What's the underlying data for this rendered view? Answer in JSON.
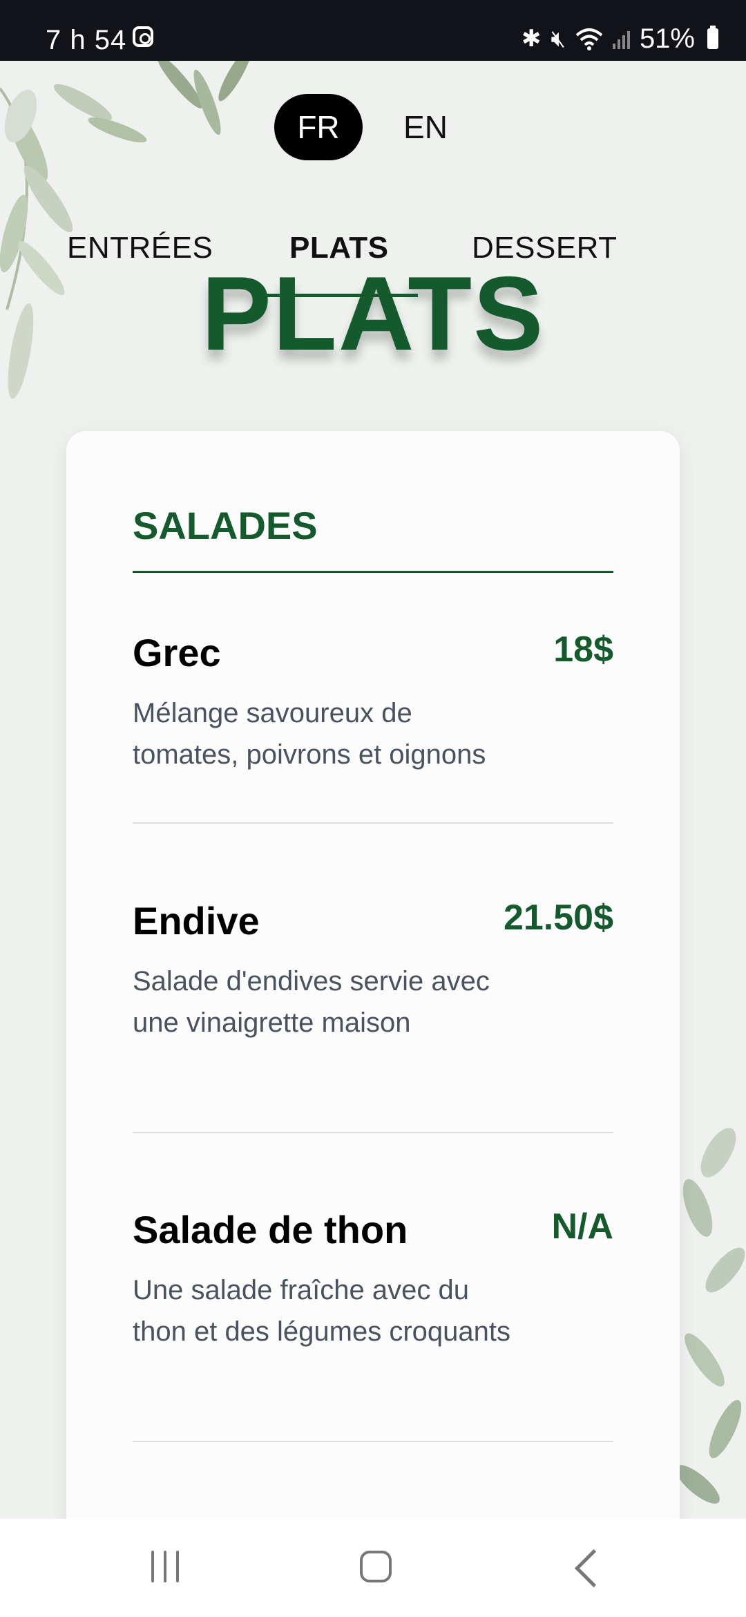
{
  "status_bar": {
    "time": "7 h 54",
    "battery": "51%",
    "icons": [
      "instagram-icon",
      "bluetooth-icon",
      "mute-icon",
      "wifi-icon",
      "signal-icon",
      "battery-icon"
    ]
  },
  "language": {
    "fr": "FR",
    "en": "EN",
    "selected": "FR"
  },
  "tabs": [
    {
      "label": "ENTRÉES"
    },
    {
      "label": "PLATS",
      "active": true
    },
    {
      "label": "DESSERT"
    }
  ],
  "page_title": "PLATS",
  "section": {
    "title": "SALADES",
    "items": [
      {
        "name": "Grec",
        "price": "18$",
        "description": "Mélange savoureux de tomates, poivrons et oignons"
      },
      {
        "name": "Endive",
        "price": "21.50$",
        "description": "Salade d'endives servie avec une vinaigrette maison"
      },
      {
        "name": "Salade de thon",
        "price": "N/A",
        "description": "Une salade fraîche avec du thon et des légumes croquants"
      }
    ]
  },
  "colors": {
    "accent": "#145a2d",
    "status_bar": "#111318",
    "background": "#eef1ee"
  },
  "nav": {
    "icons": [
      "recent-apps-icon",
      "home-icon",
      "back-icon"
    ]
  }
}
